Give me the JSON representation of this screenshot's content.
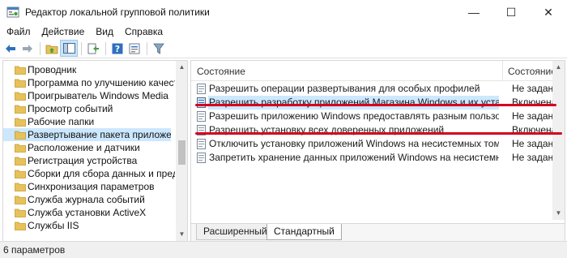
{
  "window": {
    "title": "Редактор локальной групповой политики",
    "minimize_glyph": "—",
    "maximize_glyph": "☐",
    "close_glyph": "✕"
  },
  "menu": {
    "items": [
      "Файл",
      "Действие",
      "Вид",
      "Справка"
    ]
  },
  "toolbar": {
    "icons": [
      "back-arrow-icon",
      "forward-arrow-icon",
      "up-folder-icon",
      "show-hide-tree-icon",
      "export-list-icon",
      "help-icon",
      "properties-icon",
      "filter-icon"
    ]
  },
  "tree": {
    "items": [
      {
        "label": "Проводник"
      },
      {
        "label": "Программа по улучшению качества"
      },
      {
        "label": "Проигрыватель Windows Media"
      },
      {
        "label": "Просмотр событий"
      },
      {
        "label": "Рабочие папки"
      },
      {
        "label": "Развертывание пакета приложения",
        "selected": true
      },
      {
        "label": "Расположение и датчики"
      },
      {
        "label": "Регистрация устройства"
      },
      {
        "label": "Сборки для сбора данных и предвари"
      },
      {
        "label": "Синхронизация параметров"
      },
      {
        "label": "Служба журнала событий"
      },
      {
        "label": "Служба установки ActiveX"
      },
      {
        "label": "Службы IIS"
      }
    ]
  },
  "list": {
    "col_name": "Состояние",
    "col_state": "Состояние",
    "rows": [
      {
        "name": "Разрешить операции развертывания для особых профилей",
        "state": "Не задана"
      },
      {
        "name": "Разрешить разработку приложений Магазина Windows и их установку ...",
        "state": "Включена",
        "selected": true
      },
      {
        "name": "Разрешить приложению Windows предоставлять разным пользовател...",
        "state": "Не задана"
      },
      {
        "name": "Разрешить установку всех доверенных приложений",
        "state": "Включена"
      },
      {
        "name": "Отключить установку приложений Windows на несистемных томах",
        "state": "Не задана"
      },
      {
        "name": "Запретить хранение данных приложений Windows на несистемн...",
        "state": "Не задана"
      }
    ]
  },
  "tabs": {
    "extended": "Расширенный",
    "standard": "Стандартный"
  },
  "status": {
    "text": "6 параметров"
  },
  "colors": {
    "selection": "#cce8ff",
    "annotation_red": "#d4001f",
    "folder_yellow": "#e8c15a"
  }
}
